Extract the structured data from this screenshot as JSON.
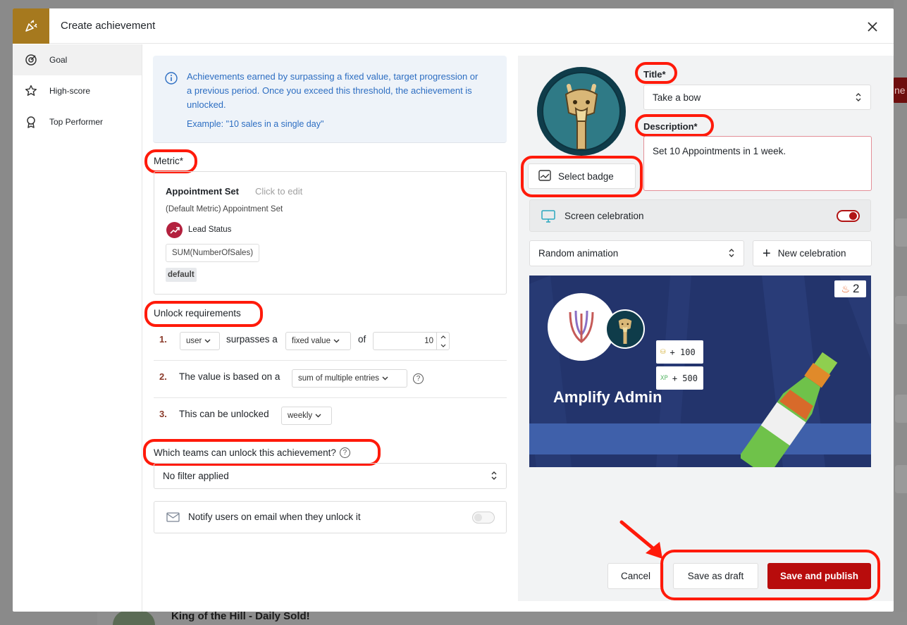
{
  "background": {
    "bottom_item_title": "King of the Hill - Daily Sold!"
  },
  "modal": {
    "title": "Create achievement",
    "header_icon": "party-popper-icon",
    "close_icon": "close-icon"
  },
  "sidebar": {
    "items": [
      {
        "label": "Goal",
        "icon": "target-icon",
        "active": true
      },
      {
        "label": "High-score",
        "icon": "star-icon",
        "active": false
      },
      {
        "label": "Top Performer",
        "icon": "award-ribbon-icon",
        "active": false
      }
    ]
  },
  "info": {
    "text": "Achievements earned by surpassing a fixed value, target progression or a previous period. Once you exceed this threshold, the achievement is unlocked.",
    "example": "Example: \"10 sales in a single day\""
  },
  "metric": {
    "section_label": "Metric*",
    "name": "Appointment Set",
    "edit_hint": "Click to edit",
    "default_label": "(Default Metric) Appointment Set",
    "status_label": "Lead Status",
    "formula": "SUM(NumberOfSales)",
    "tag": "default"
  },
  "unlock": {
    "section_label": "Unlock requirements",
    "rows": [
      {
        "num": "1.",
        "subject": "user",
        "text": "surpasses a",
        "mode": "fixed value",
        "of_text": "of",
        "value": "10"
      },
      {
        "num": "2.",
        "text": "The value is based on a",
        "basis": "sum of multiple entries"
      },
      {
        "num": "3.",
        "text": "This can be unlocked",
        "period": "weekly"
      }
    ]
  },
  "teams": {
    "section_label": "Which teams can unlock this achievement?",
    "value": "No filter applied"
  },
  "notify": {
    "label": "Notify users on email when they unlock it",
    "enabled": false
  },
  "badge": {
    "select_label": "Select badge",
    "title_label": "Title*",
    "title_value": "Take a bow",
    "description_label": "Description*",
    "description_value": "Set 10 Appointments in 1 week."
  },
  "celebration": {
    "label": "Screen celebration",
    "enabled": true,
    "animation": "Random animation",
    "new_label": "New celebration"
  },
  "preview": {
    "name": "Amplify Admin",
    "coins": "+ 100",
    "xp_tag": "XP",
    "xp": "+ 500",
    "streak": "2"
  },
  "footer": {
    "cancel": "Cancel",
    "draft": "Save as draft",
    "publish": "Save and publish"
  },
  "colors": {
    "accent": "#b80c0c",
    "highlight_ring": "#ff1a0a",
    "header_icon_bg": "#a6791e",
    "info_text": "#2d6ec2"
  }
}
